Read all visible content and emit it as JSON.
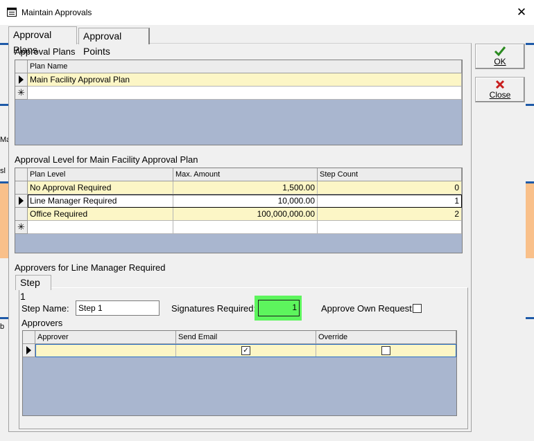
{
  "window": {
    "title": "Maintain Approvals",
    "close_glyph": "✕"
  },
  "tabs": [
    {
      "label": "Approval Plans",
      "active": true
    },
    {
      "label": "Approval Points",
      "active": false
    }
  ],
  "behind": {
    "fragment_1": "Ma",
    "fragment_2": "sl",
    "fragment_3": "b"
  },
  "buttons": {
    "ok": {
      "label": "OK",
      "icon": "checkmark-icon",
      "color": "#2a8a1f"
    },
    "close": {
      "label": "Close",
      "icon": "x-icon",
      "color": "#c81e1e"
    }
  },
  "plans": {
    "section_label": "Approval Plans",
    "columns": [
      "Plan Name"
    ],
    "rows": [
      {
        "name": "Main Facility Approval Plan"
      }
    ],
    "new_row_marker": "✳"
  },
  "levels": {
    "section_label": "Approval Level for Main Facility Approval Plan",
    "columns": [
      "Plan Level",
      "Max. Amount",
      "Step Count"
    ],
    "rows": [
      {
        "level": "No Approval Required",
        "max": "1,500.00",
        "steps": "0"
      },
      {
        "level": "Line Manager Required",
        "max": "10,000.00",
        "steps": "1"
      },
      {
        "level": "Office Required",
        "max": "100,000,000.00",
        "steps": "2"
      }
    ],
    "new_row_marker": "✳"
  },
  "approvers_section": {
    "label": "Approvers for Line Manager Required",
    "step_tab": "Step 1",
    "step_name_label": "Step Name:",
    "step_name_value": "Step 1",
    "signatures_label": "Signatures Required:",
    "signatures_value": "1",
    "signatures_highlight": "#5df55d",
    "approve_own_label": "Approve Own Request:",
    "approve_own_checked": false,
    "approvers_label": "Approvers",
    "columns": [
      "Approver",
      "Send Email",
      "Override"
    ],
    "rows": [
      {
        "approver": "",
        "send_email": "✓",
        "override": ""
      }
    ]
  },
  "colors": {
    "grid_bg": "#a9b6cf",
    "row_yellow": "#fcf6c6"
  }
}
